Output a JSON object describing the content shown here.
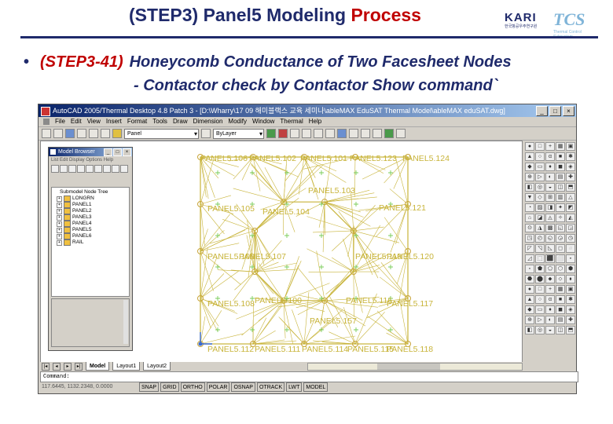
{
  "slide": {
    "title_main": "(STEP3) Panel5 Modeling ",
    "title_accent": "Process",
    "bullet_step": "(STEP3-41)",
    "bullet_text": "Honeycomb Conductance of Two Facesheet Nodes",
    "sub_text": "- Contactor check by Contactor Show command`",
    "logo_karf": "KARI",
    "logo_karf_sub": "한국항공우주연구원",
    "logo_tcs": "TCS",
    "logo_tcs_sub": "Thermal Control Subsystem"
  },
  "app": {
    "window_title": "AutoCAD 2005/Thermal Desktop 4.8 Patch 3 - [D:\\Wharry\\17 09 해미블랙스 교육 세미나\\ableMAX EduSAT Thermal Model\\ableMAX eduSAT.dwg]",
    "menus": [
      "File",
      "Edit",
      "View",
      "Insert",
      "Format",
      "Tools",
      "Draw",
      "Dimension",
      "Modify",
      "Window",
      "Thermal",
      "Help"
    ],
    "layer_combo": "Panel",
    "linetype_combo": "ByLayer",
    "tabs": [
      "Model",
      "Layout1",
      "Layout2"
    ],
    "active_tab": "Model",
    "command_prompt": "Command:",
    "coords": "117.6445, 1132.2348, 0.0000",
    "status_buttons": [
      "SNAP",
      "GRID",
      "ORTHO",
      "POLAR",
      "OSNAP",
      "OTRACK",
      "LWT",
      "MODEL"
    ]
  },
  "model_browser": {
    "title": "Model Browser",
    "menu": "List  Edit  Display  Options  Help",
    "tree_root": "Submodel Node Tree",
    "tree_items": [
      "LONGRN",
      "PANEL1",
      "PANEL2",
      "PANEL3",
      "PANEL4",
      "PANEL5",
      "PANEL6",
      "RAIL"
    ]
  },
  "drawing_labels": [
    "PANEL5.106",
    "PANEL5.102",
    "PANEL5.101",
    "PANEL5.123",
    "PANEL5.124",
    "PANEL5.103",
    "PANEL5.105",
    "PANEL5.104",
    "PANEL5.121",
    "PANEL5.109",
    "PANEL5.107",
    "PANEL5.119",
    "PANEL5.120",
    "PANEL5.108",
    "PANEL5.100",
    "PANEL5.116",
    "PANEL5.117",
    "PANEL5.157",
    "PANEL5.112",
    "PANEL5.111",
    "PANEL5.114",
    "PANEL5.115",
    "PANEL5.118"
  ],
  "colors": {
    "drawing_line": "#c8b43a",
    "node": "#c8a43a",
    "cross": "#7acc5a",
    "slide_blue": "#1f2a6b",
    "slide_red": "#c00000"
  }
}
